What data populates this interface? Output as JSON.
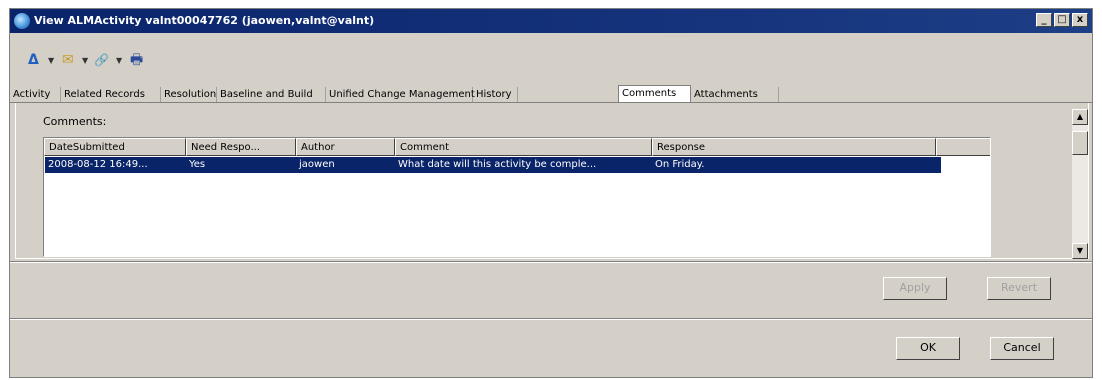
{
  "window": {
    "title": "View ALMActivity valnt00047762 (jaowen,valnt@valnt)",
    "controls": {
      "minimize": "_",
      "maximize": "□",
      "close": "x"
    }
  },
  "toolbar": {
    "items": [
      {
        "icon": "drawing-icon",
        "glyph": "Δ"
      },
      {
        "icon": "dropdown-arrow-icon",
        "glyph": "▼"
      },
      {
        "icon": "email-icon",
        "glyph": "✉"
      },
      {
        "icon": "dropdown-arrow-icon",
        "glyph": "▼"
      },
      {
        "icon": "link-icon",
        "glyph": "🔗"
      },
      {
        "icon": "dropdown-arrow-icon",
        "glyph": "▼"
      },
      {
        "icon": "print-icon",
        "glyph": "🖶"
      }
    ]
  },
  "tabs": [
    {
      "label": "Activity",
      "active": false
    },
    {
      "label": "Related Records",
      "active": false
    },
    {
      "label": "Resolution",
      "active": false
    },
    {
      "label": "Baseline and Build",
      "active": false
    },
    {
      "label": "Unified Change Management",
      "active": false
    },
    {
      "label": "History",
      "active": false
    },
    {
      "label": "Comments",
      "active": true
    },
    {
      "label": "Attachments",
      "active": false
    }
  ],
  "comments": {
    "label": "Comments:",
    "columns": [
      "DateSubmitted",
      "Need Respo...",
      "Author",
      "Comment",
      "Response"
    ],
    "rows": [
      {
        "date_submitted": "2008-08-12 16:49...",
        "need_response": "Yes",
        "author": "jaowen",
        "comment": "What date will this activity be comple...",
        "response": "On Friday."
      }
    ]
  },
  "buttons": {
    "apply": "Apply",
    "revert": "Revert",
    "ok": "OK",
    "cancel": "Cancel"
  },
  "colors": {
    "titlebar": "#0a246a",
    "selection": "#0a246a",
    "face": "#d4d0c8"
  }
}
